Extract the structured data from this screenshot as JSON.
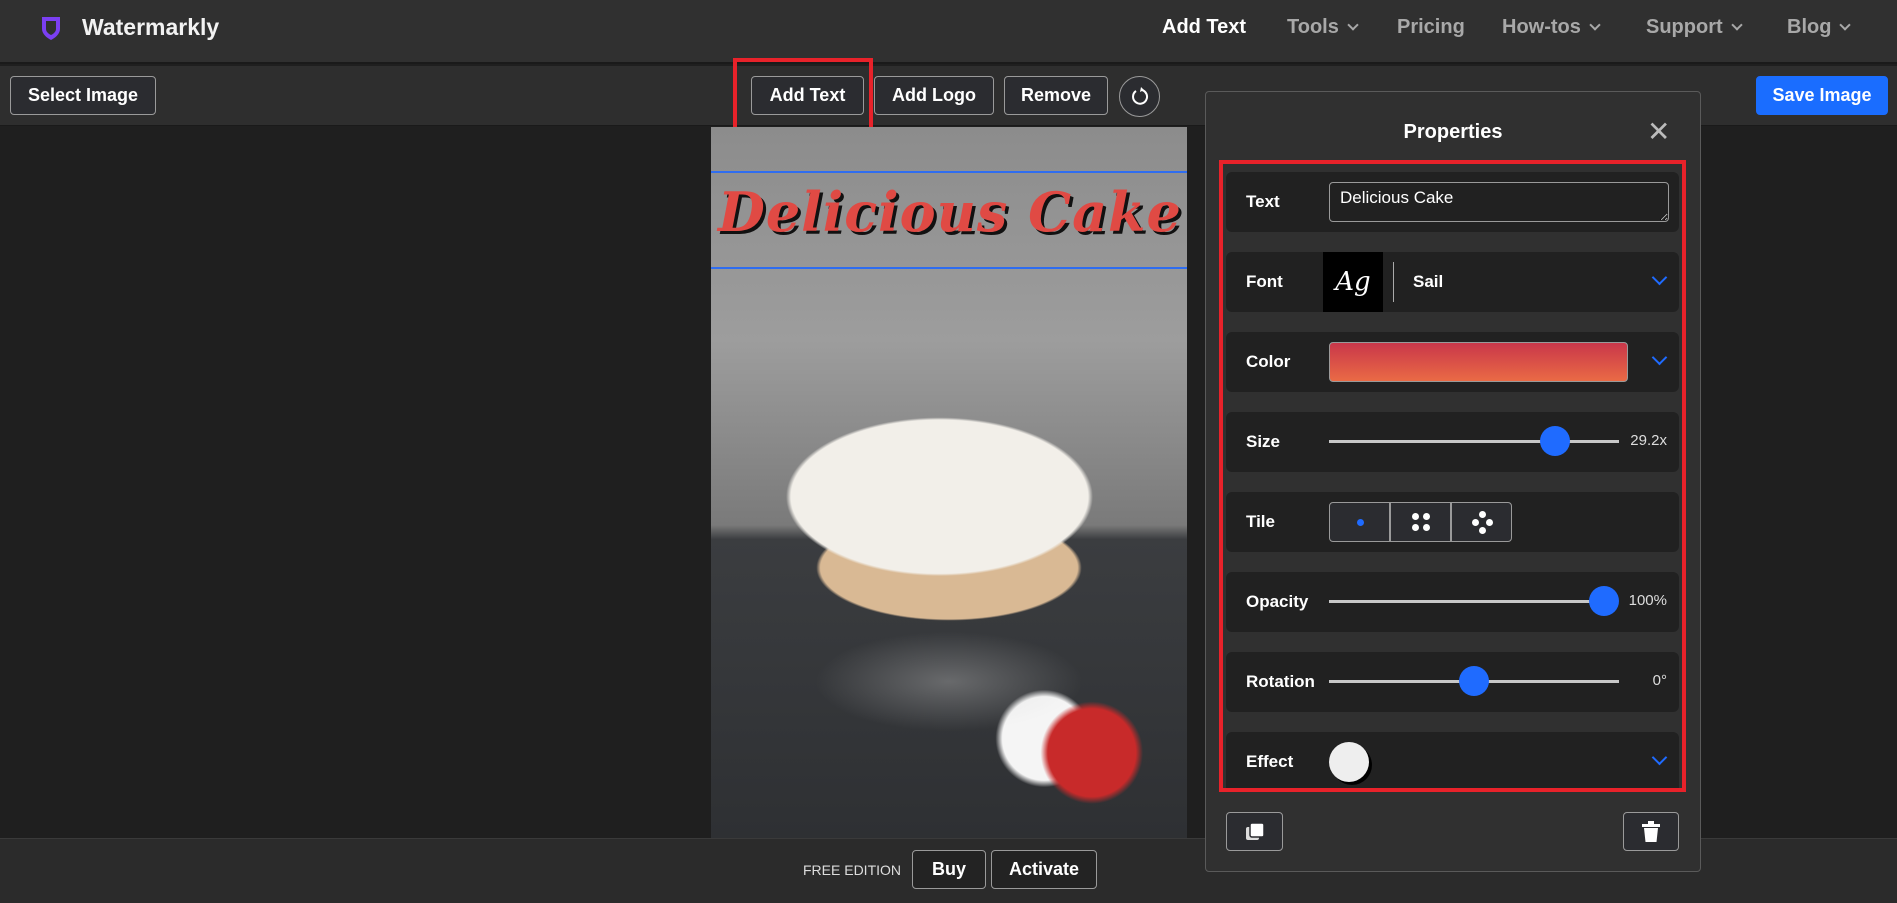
{
  "header": {
    "brand": "Watermarkly",
    "nav": [
      {
        "label": "Add Text",
        "active": true,
        "dropdown": false
      },
      {
        "label": "Tools",
        "dropdown": true
      },
      {
        "label": "Pricing",
        "dropdown": false
      },
      {
        "label": "How-tos",
        "dropdown": true
      },
      {
        "label": "Support",
        "dropdown": true
      },
      {
        "label": "Blog",
        "dropdown": true
      }
    ]
  },
  "toolbar": {
    "select_image": "Select Image",
    "add_text": "Add Text",
    "add_logo": "Add Logo",
    "remove": "Remove",
    "save_image": "Save Image"
  },
  "canvas": {
    "watermark_text": "Delicious Cake"
  },
  "footer": {
    "edition": "FREE EDITION",
    "buy": "Buy",
    "activate": "Activate"
  },
  "properties": {
    "title": "Properties",
    "text_label": "Text",
    "text_value": "Delicious Cake",
    "font_label": "Font",
    "font_preview": "Ag",
    "font_name": "Sail",
    "color_label": "Color",
    "color_from": "#c9374a",
    "color_to": "#ea6a45",
    "size_label": "Size",
    "size_value": "29.2x",
    "size_fraction": 0.78,
    "tile_label": "Tile",
    "tile_selected": "single",
    "opacity_label": "Opacity",
    "opacity_value": "100%",
    "opacity_fraction": 1.0,
    "rotation_label": "Rotation",
    "rotation_value": "0°",
    "rotation_fraction": 0.5,
    "effect_label": "Effect"
  },
  "colors": {
    "accent": "#1f6bff",
    "highlight": "#e8222a"
  }
}
